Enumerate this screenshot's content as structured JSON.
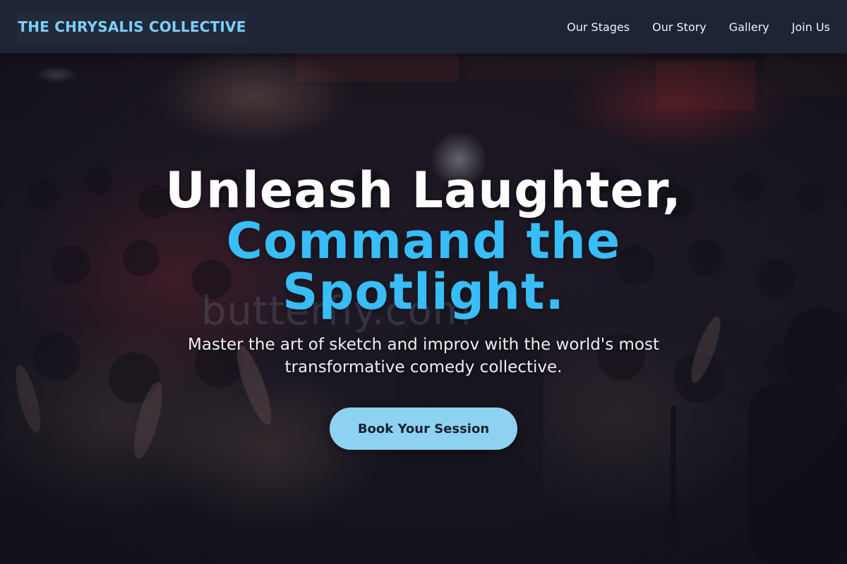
{
  "nav": {
    "brand": "THE CHRYSALIS COLLECTIVE",
    "links": [
      "Our Stages",
      "Our Story",
      "Gallery",
      "Join Us"
    ]
  },
  "hero": {
    "headline_line1": "Unleash Laughter,",
    "headline_line2": "Command the",
    "headline_line3": "Spotlight.",
    "subtitle_line1": "Master the art of sketch and improv with the world's most",
    "subtitle_line2": "transformative comedy collective.",
    "cta_label": "Book Your Session",
    "watermark": "butterfly.com"
  },
  "colors": {
    "nav_bg": "#1e2435",
    "brand_text": "#7dcff6",
    "headline_white": "#ffffff",
    "headline_accent": "#38bdf8",
    "cta_bg": "#8ed2f1",
    "cta_text": "#1a2233"
  }
}
